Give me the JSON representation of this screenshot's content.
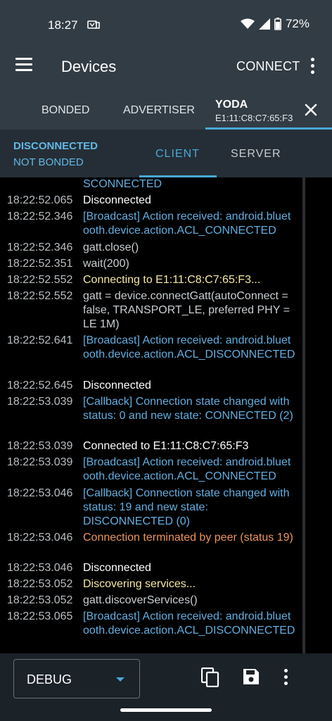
{
  "status_bar": {
    "time": "18:27",
    "battery_percent": "72%"
  },
  "app_bar": {
    "title": "Devices",
    "connect_label": "CONNECT"
  },
  "tabs": {
    "bonded": "BONDED",
    "advertiser": "ADVERTISER",
    "device_name": "YODA",
    "device_mac": "E1:11:C8:C7:65:F3"
  },
  "connection": {
    "state": "DISCONNECTED",
    "bond_state": "NOT BONDED",
    "client_tab": "CLIENT",
    "server_tab": "SERVER"
  },
  "log": [
    {
      "time": "",
      "text": "SCONNECTED",
      "level": "info"
    },
    {
      "time": "18:22:52.065",
      "text": "Disconnected",
      "level": "state"
    },
    {
      "time": "18:22:52.346",
      "text": "[Broadcast] Action received: android.bluetooth.device.action.ACL_CONNECTED",
      "level": "info"
    },
    {
      "time": "18:22:52.346",
      "text": "gatt.close()",
      "level": "verbose"
    },
    {
      "time": "18:22:52.351",
      "text": "wait(200)",
      "level": "verbose"
    },
    {
      "time": "18:22:52.552",
      "text": "Connecting to E1:11:C8:C7:65:F3...",
      "level": "warn"
    },
    {
      "time": "18:22:52.552",
      "text": "gatt = device.connectGatt(autoConnect = false, TRANSPORT_LE, preferred PHY = LE 1M)",
      "level": "verbose"
    },
    {
      "time": "18:22:52.641",
      "text": "[Broadcast] Action received: android.bluetooth.device.action.ACL_DISCONNECTED",
      "level": "info"
    },
    {
      "time": "18:22:52.645",
      "text": "Disconnected",
      "level": "state"
    },
    {
      "time": "18:22:53.039",
      "text": "[Callback] Connection state changed with status: 0 and new state: CONNECTED (2)",
      "level": "info"
    },
    {
      "time": "18:22:53.039",
      "text": "Connected to E1:11:C8:C7:65:F3",
      "level": "state"
    },
    {
      "time": "18:22:53.039",
      "text": "[Broadcast] Action received: android.bluetooth.device.action.ACL_CONNECTED",
      "level": "info"
    },
    {
      "time": "18:22:53.046",
      "text": "[Callback] Connection state changed with status: 19 and new state: DISCONNECTED (0)",
      "level": "info"
    },
    {
      "time": "18:22:53.046",
      "text": "Connection terminated by peer (status 19)",
      "level": "error"
    },
    {
      "time": "18:22:53.046",
      "text": "Disconnected",
      "level": "state"
    },
    {
      "time": "18:22:53.052",
      "text": "Discovering services...",
      "level": "warn"
    },
    {
      "time": "18:22:53.052",
      "text": "gatt.discoverServices()",
      "level": "verbose"
    },
    {
      "time": "18:22:53.065",
      "text": "[Broadcast] Action received: android.bluetooth.device.action.ACL_DISCONNECTED",
      "level": "info"
    }
  ],
  "bottom_bar": {
    "log_level": "DEBUG"
  },
  "colors": {
    "toolbar": "#323c44",
    "accent": "#4aa8d8",
    "info": "#62aedf",
    "warn": "#f5e8a0",
    "error": "#e9955d"
  }
}
